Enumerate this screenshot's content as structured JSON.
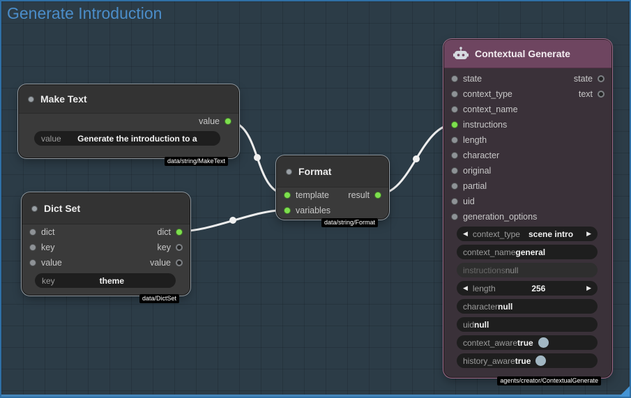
{
  "icons": {
    "combo_prev": "◀",
    "combo_next": "▶"
  },
  "window": {
    "title": "Generate Introduction"
  },
  "nodes": {
    "make_text": {
      "title": "Make Text",
      "badge": "data/string/MakeText",
      "outputs": [
        {
          "name": "value"
        }
      ],
      "widgets": [
        {
          "label": "value",
          "value": "Generate the introduction to a"
        }
      ]
    },
    "dict_set": {
      "title": "Dict Set",
      "badge": "data/DictSet",
      "inputs": [
        {
          "name": "dict"
        },
        {
          "name": "key"
        },
        {
          "name": "value"
        }
      ],
      "outputs": [
        {
          "name": "dict"
        },
        {
          "name": "key"
        },
        {
          "name": "value"
        }
      ],
      "widgets": [
        {
          "label": "key",
          "value": "theme"
        }
      ]
    },
    "format": {
      "title": "Format",
      "badge": "data/string/Format",
      "inputs": [
        {
          "name": "template"
        },
        {
          "name": "variables"
        }
      ],
      "outputs": [
        {
          "name": "result"
        }
      ]
    },
    "contextual_generate": {
      "title": "Contextual Generate",
      "badge": "agents/creator/ContextualGenerate",
      "inputs": [
        {
          "name": "state"
        },
        {
          "name": "context_type"
        },
        {
          "name": "context_name"
        },
        {
          "name": "instructions"
        },
        {
          "name": "length"
        },
        {
          "name": "character"
        },
        {
          "name": "original"
        },
        {
          "name": "partial"
        },
        {
          "name": "uid"
        },
        {
          "name": "generation_options"
        }
      ],
      "outputs": [
        {
          "name": "state"
        },
        {
          "name": "text"
        }
      ],
      "widgets": [
        {
          "type": "combo",
          "label": "context_type",
          "value": "scene intro"
        },
        {
          "type": "text",
          "label": "context_name",
          "value": "general"
        },
        {
          "type": "disabled",
          "label": "instructions",
          "value": "null"
        },
        {
          "type": "combo",
          "label": "length",
          "value": "256"
        },
        {
          "type": "text",
          "label": "character",
          "value": "null"
        },
        {
          "type": "text",
          "label": "uid",
          "value": "null"
        },
        {
          "type": "toggle",
          "label": "context_aware",
          "value": "true"
        },
        {
          "type": "toggle",
          "label": "history_aware",
          "value": "true"
        }
      ]
    }
  }
}
